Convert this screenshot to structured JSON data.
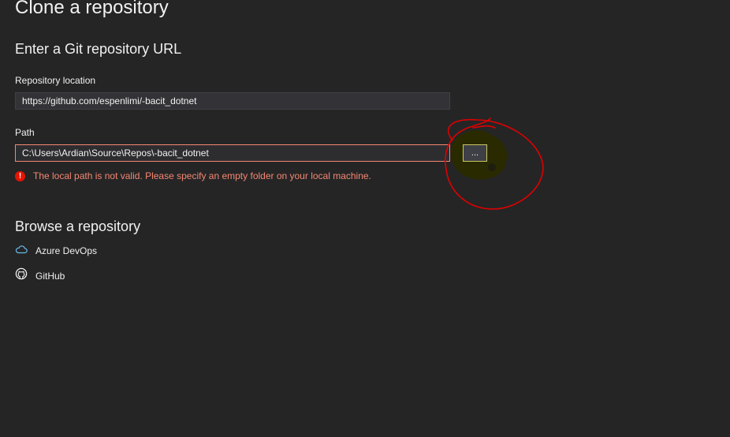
{
  "page": {
    "title": "Clone a repository"
  },
  "git_url_section": {
    "heading": "Enter a Git repository URL",
    "repository_location_label": "Repository location",
    "repository_location_value": "https://github.com/espenlimi/-bacit_dotnet",
    "path_label": "Path",
    "path_value": "C:\\Users\\Ardian\\Source\\Repos\\-bacit_dotnet",
    "browse_button_label": "...",
    "error_message": "The local path is not valid. Please specify an empty folder on your local machine."
  },
  "browse_section": {
    "heading": "Browse a repository",
    "items": [
      {
        "label": "Azure DevOps",
        "icon": "cloud-icon"
      },
      {
        "label": "GitHub",
        "icon": "github-icon"
      }
    ]
  },
  "colors": {
    "background": "#252526",
    "error": "#f48771",
    "annotation_red": "#e00000",
    "annotation_fill": "#2a2a00"
  }
}
